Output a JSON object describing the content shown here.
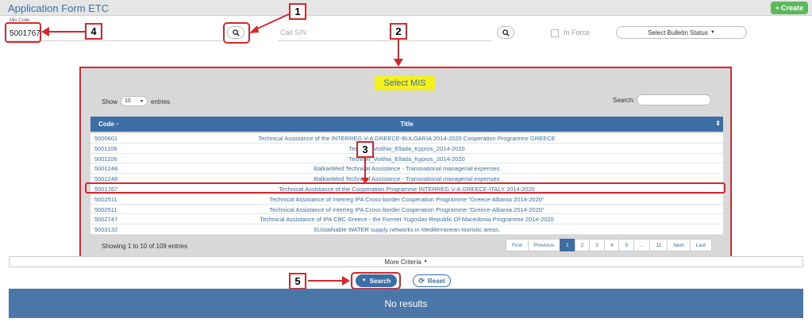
{
  "header": {
    "title": "Application Form ETC",
    "create_label": "Create",
    "create_icon": "plus-icon"
  },
  "filters": {
    "mis_code_label": "Mis Code",
    "mis_code_value": "5001767",
    "call_placeholder": "Call S/N",
    "in_force_label": "In Force",
    "bulletin_status": "Select Bulletin Status"
  },
  "modal": {
    "title": "Select MIS",
    "show_label": "Show",
    "entries_value": "10",
    "entries_label": "entries",
    "search_label": "Search:",
    "columns": {
      "code": "Code",
      "title": "Title"
    },
    "rows": [
      {
        "code": "5000601",
        "title": "Technical Assistance of the INTERREG V-A GREECE-BULGARIA 2014-2020 Cooperation Programme GREECE"
      },
      {
        "code": "5001106",
        "title": "Techniki_Voithia_Ellada_Kypros_2014-2020"
      },
      {
        "code": "5001106",
        "title": "Techniki_Voithia_Ellada_Kypros_2014-2020"
      },
      {
        "code": "5001248",
        "title": "BalkanMed Technical Assistance - Transnational managerial expenses"
      },
      {
        "code": "5001248",
        "title": "BalkanMed Technical Assistance - Transnational managerial expenses"
      },
      {
        "code": "5001767",
        "title": "Technical Assistance of the Cooperation Programme INTERREG V-A GREECE-ITALY 2014-2020"
      },
      {
        "code": "5002511",
        "title": "Technical Assistance of Interreg IPA Cross-border Cooperation Programme \"Greece-Albania 2014-2020\""
      },
      {
        "code": "5002511",
        "title": "Technical Assistance of Interreg IPA Cross-border Cooperation Programme \"Greece-Albania 2014-2020\""
      },
      {
        "code": "5002747",
        "title": "Technical Assistance of IPA CBC Greece - the Former Yugoslav Republic Of Macedonia Programme 2014-2020"
      },
      {
        "code": "5003132",
        "title": "SUstaiNable WATER supply networks in Mediterranean touristic areas."
      }
    ],
    "info": "Showing 1 to 10 of 109 entries",
    "pager": [
      "First",
      "Previous",
      "1",
      "2",
      "3",
      "4",
      "5",
      "...",
      "11",
      "Next",
      "Last"
    ],
    "active_page": "1"
  },
  "more_criteria": "More Criteria",
  "buttons": {
    "search": "Search",
    "reset": "Reset"
  },
  "results": "No results",
  "callouts": [
    "1",
    "2",
    "3",
    "4",
    "5"
  ],
  "colors": {
    "primary": "#3a6ea5",
    "annotation_red": "#d9262d",
    "highlight": "#f4f11f",
    "create_green": "#5cb85c"
  }
}
